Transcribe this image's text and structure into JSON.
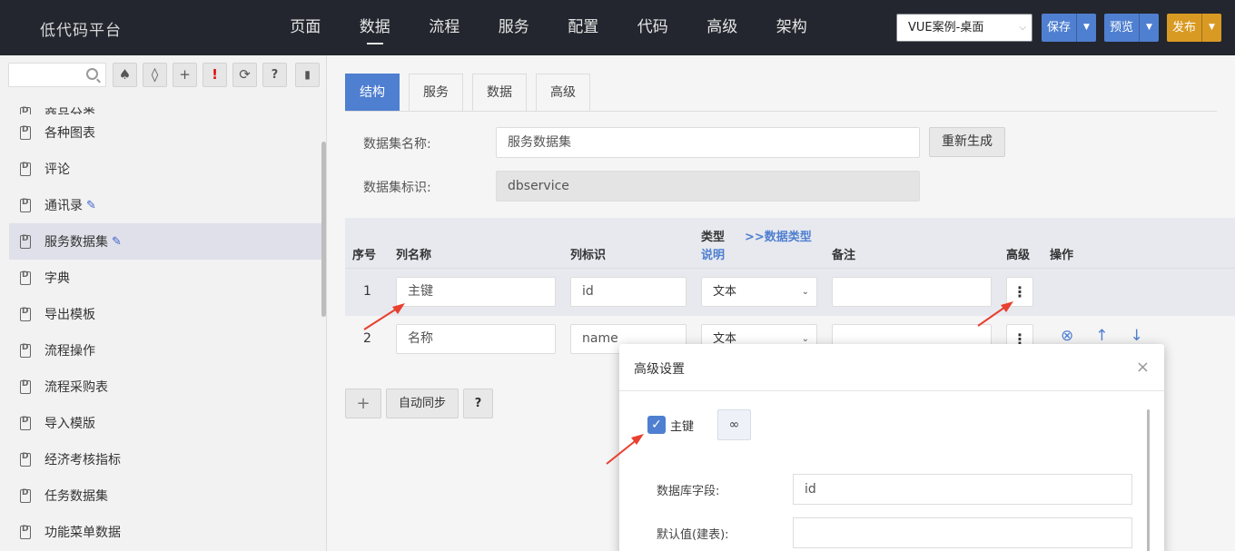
{
  "app": {
    "brand": "低代码平台"
  },
  "nav": [
    {
      "label": "页面",
      "active": false
    },
    {
      "label": "数据",
      "active": true
    },
    {
      "label": "流程",
      "active": false
    },
    {
      "label": "服务",
      "active": false
    },
    {
      "label": "配置",
      "active": false
    },
    {
      "label": "代码",
      "active": false
    },
    {
      "label": "高级",
      "active": false
    },
    {
      "label": "架构",
      "active": false
    }
  ],
  "toolbar": {
    "project_select": "VUE案例-桌面",
    "save": "保存",
    "preview": "预览",
    "publish": "发布"
  },
  "sidebar": {
    "search_placeholder": "",
    "items": [
      {
        "label": "商品分类",
        "edit": false,
        "selected": false,
        "partial": true
      },
      {
        "label": "各种图表",
        "edit": false,
        "selected": false
      },
      {
        "label": "评论",
        "edit": false,
        "selected": false
      },
      {
        "label": "通讯录",
        "edit": true,
        "selected": false
      },
      {
        "label": "服务数据集",
        "edit": true,
        "selected": true
      },
      {
        "label": "字典",
        "edit": false,
        "selected": false
      },
      {
        "label": "导出模板",
        "edit": false,
        "selected": false
      },
      {
        "label": "流程操作",
        "edit": false,
        "selected": false
      },
      {
        "label": "流程采购表",
        "edit": false,
        "selected": false
      },
      {
        "label": "导入模版",
        "edit": false,
        "selected": false
      },
      {
        "label": "经济考核指标",
        "edit": false,
        "selected": false
      },
      {
        "label": "任务数据集",
        "edit": false,
        "selected": false
      },
      {
        "label": "功能菜单数据",
        "edit": false,
        "selected": false
      }
    ]
  },
  "tabs": [
    "结构",
    "服务",
    "数据",
    "高级"
  ],
  "form": {
    "name_label": "数据集名称:",
    "name_value": "服务数据集",
    "regen_button": "重新生成",
    "id_label": "数据集标识:",
    "id_value": "dbservice"
  },
  "columns": {
    "index": "序号",
    "name": "列名称",
    "key": "列标识",
    "type": "类型",
    "type_desc": "说明",
    "type_link": ">>数据类型",
    "remark": "备注",
    "advanced": "高级",
    "actions": "操作"
  },
  "rows": [
    {
      "index": "1",
      "name": "主键",
      "key": "id",
      "type": "文本",
      "remark": ""
    },
    {
      "index": "2",
      "name": "名称",
      "key": "name",
      "type": "文本",
      "remark": ""
    }
  ],
  "bottom": {
    "add": "+",
    "sync": "自动同步",
    "help": "?"
  },
  "dialog": {
    "title": "高级设置",
    "close": "×",
    "pk_label": "主键",
    "pk_checked": true,
    "db_field_label": "数据库字段:",
    "db_field_value": "id",
    "default_label": "默认值(建表):",
    "default_value": ""
  },
  "colors": {
    "topbar": "#23262e",
    "accent": "#4f7fd0",
    "publish": "#d99a23",
    "arrow": "#e8402f"
  }
}
